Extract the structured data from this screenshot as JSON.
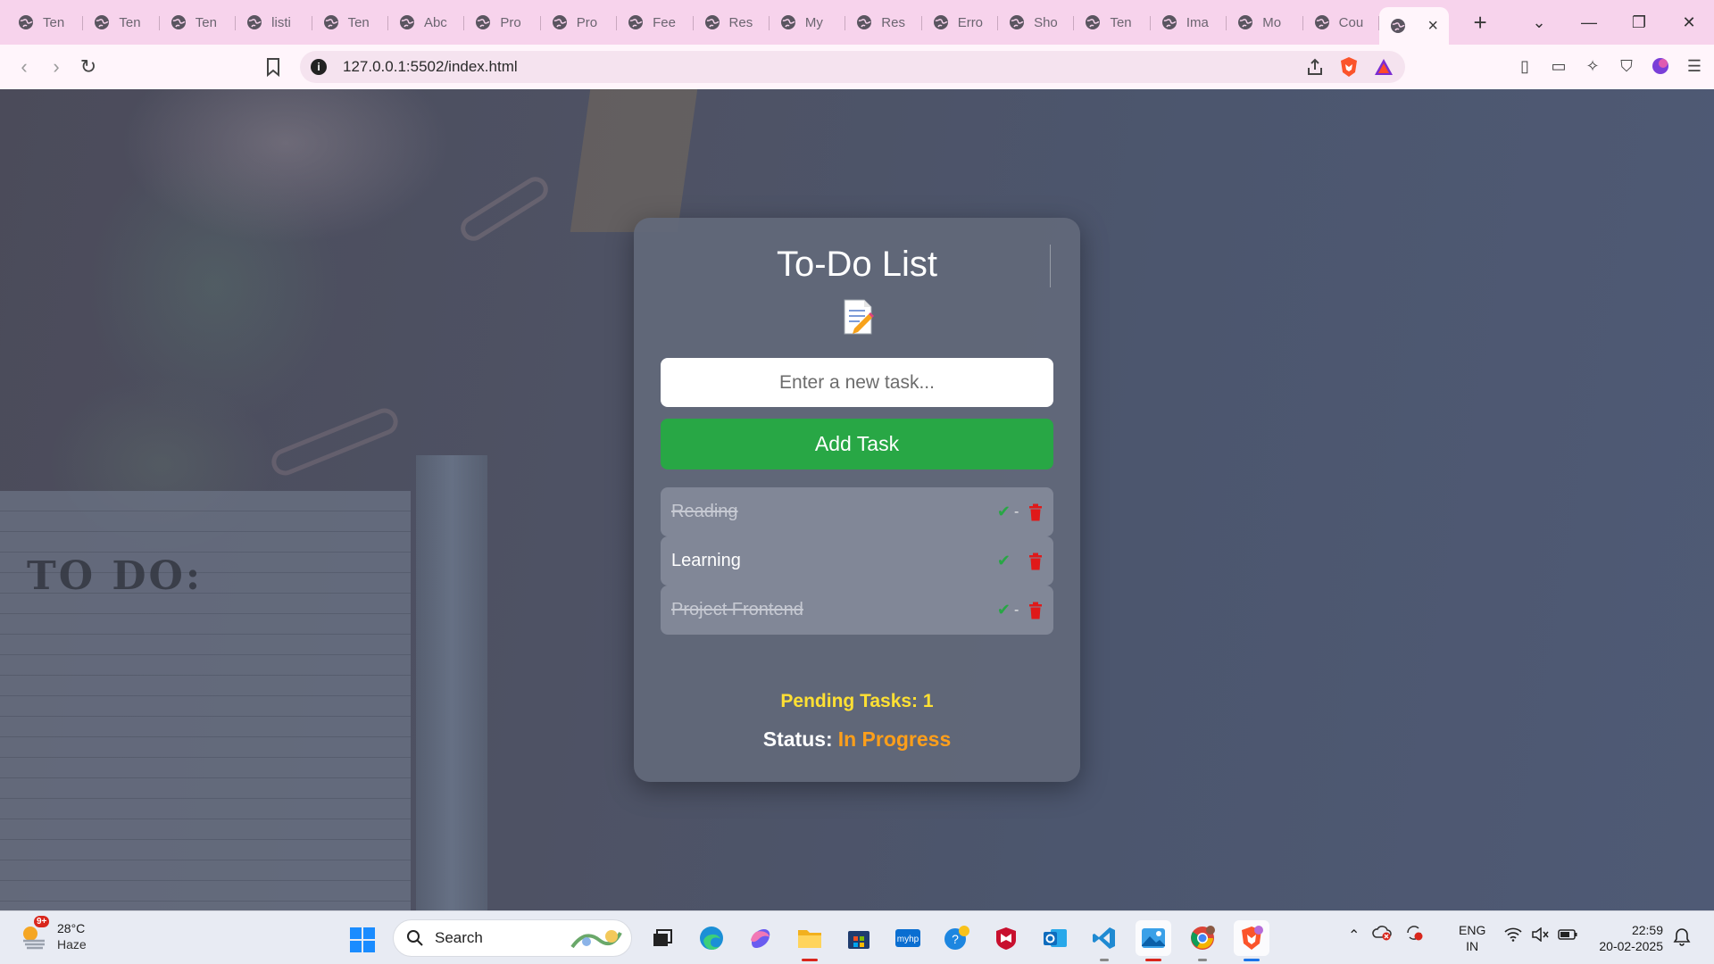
{
  "browser": {
    "tabs": [
      {
        "label": "Ten",
        "active": false
      },
      {
        "label": "Ten",
        "active": false
      },
      {
        "label": "Ten",
        "active": false
      },
      {
        "label": "listi",
        "active": false
      },
      {
        "label": "Ten",
        "active": false
      },
      {
        "label": "Abc",
        "active": false
      },
      {
        "label": "Pro",
        "active": false
      },
      {
        "label": "Pro",
        "active": false
      },
      {
        "label": "Fee",
        "active": false
      },
      {
        "label": "Res",
        "active": false
      },
      {
        "label": "My",
        "active": false
      },
      {
        "label": "Res",
        "active": false
      },
      {
        "label": "Erro",
        "active": false
      },
      {
        "label": "Sho",
        "active": false
      },
      {
        "label": "Ten",
        "active": false
      },
      {
        "label": "Ima",
        "active": false
      },
      {
        "label": "Mo",
        "active": false
      },
      {
        "label": "Cou",
        "active": false
      },
      {
        "label": "",
        "active": true
      }
    ],
    "url": "127.0.0.1:5502/index.html"
  },
  "app": {
    "title": "To-Do List",
    "input_placeholder": "Enter a new task...",
    "input_value": "",
    "add_button_label": "Add Task",
    "tasks": [
      {
        "text": "Reading",
        "completed": true
      },
      {
        "text": "Learning",
        "completed": false
      },
      {
        "text": "Project Frontend",
        "completed": true
      }
    ],
    "pending_label": "Pending Tasks: 1",
    "status_label": "Status:",
    "status_value": "In Progress",
    "colors": {
      "add_button": "#28a745",
      "pending_text": "#ffe033",
      "status_value": "#ff9f1a",
      "check": "#28a745",
      "trash": "#e01919"
    }
  },
  "background": {
    "notepad_text": "TO DO:"
  },
  "taskbar": {
    "weather_temp": "28°C",
    "weather_condition": "Haze",
    "weather_badge": "9+",
    "search_label": "Search",
    "lang_line1": "ENG",
    "lang_line2": "IN",
    "time": "22:59",
    "date": "20-02-2025"
  }
}
